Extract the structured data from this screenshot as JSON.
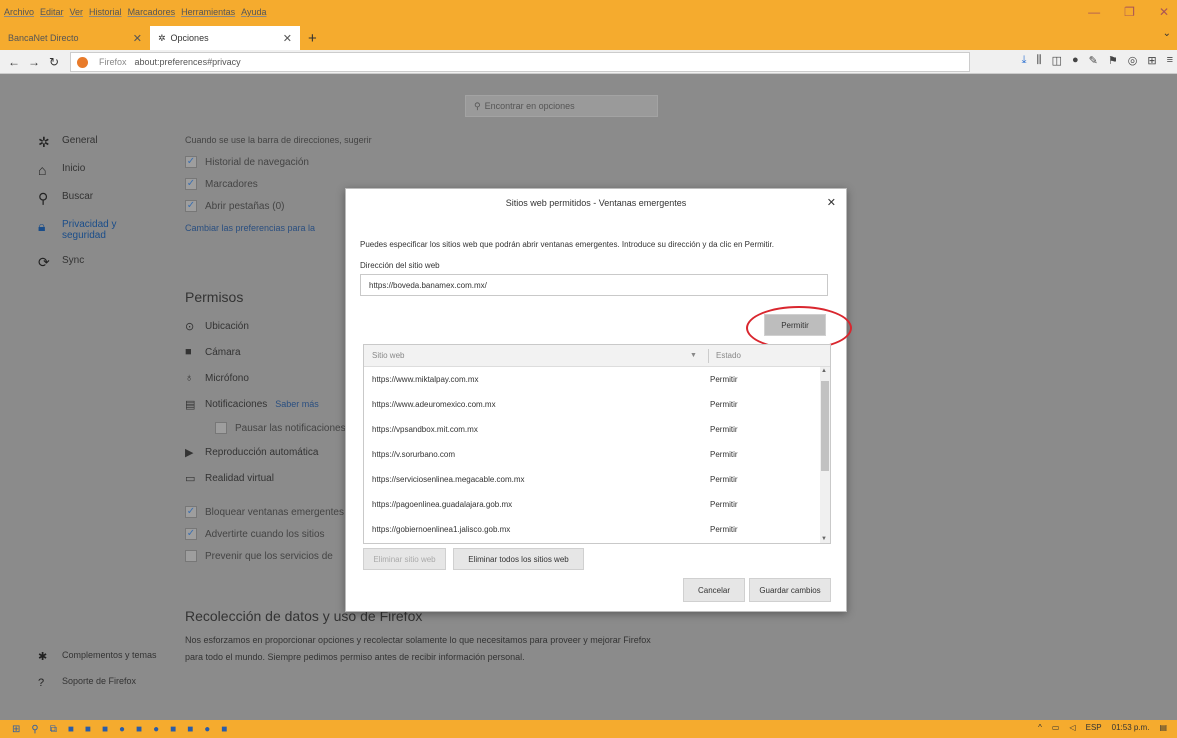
{
  "menu": [
    "Archivo",
    "Editar",
    "Ver",
    "Historial",
    "Marcadores",
    "Herramientas",
    "Ayuda"
  ],
  "tabs": [
    {
      "label": "BancaNet Directo",
      "active": false
    },
    {
      "label": "Opciones",
      "active": true
    }
  ],
  "url": {
    "brand": "Firefox",
    "address": "about:preferences#privacy"
  },
  "search": {
    "placeholder": "Encontrar en opciones"
  },
  "sidebar": {
    "items": [
      {
        "label": "General",
        "icon": "gear-icon"
      },
      {
        "label": "Inicio",
        "icon": "home-icon"
      },
      {
        "label": "Buscar",
        "icon": "search-icon"
      },
      {
        "label": "Privacidad y seguridad",
        "icon": "lock-icon",
        "selected": true
      },
      {
        "label": "Sync",
        "icon": "sync-icon"
      }
    ],
    "footer": [
      {
        "label": "Complementos y temas",
        "icon": "puzzle-icon"
      },
      {
        "label": "Soporte de Firefox",
        "icon": "help-icon"
      }
    ]
  },
  "content": {
    "address_hint": "Cuando se use la barra de direcciones, sugerir",
    "address_options": [
      "Historial de navegación",
      "Marcadores",
      "Abrir pestañas (0)"
    ],
    "change_prefs_link": "Cambiar las preferencias para la",
    "permissions_title": "Permisos",
    "permissions": [
      {
        "label": "Ubicación",
        "icon": "location-icon"
      },
      {
        "label": "Cámara",
        "icon": "camera-icon"
      },
      {
        "label": "Micrófono",
        "icon": "microphone-icon"
      },
      {
        "label": "Notificaciones",
        "icon": "notification-icon",
        "link": "Saber más"
      },
      {
        "label": "Reproducción automática",
        "icon": "autoplay-icon"
      },
      {
        "label": "Realidad virtual",
        "icon": "vr-icon"
      }
    ],
    "pause_notifications": "Pausar las notificaciones",
    "popup_options": [
      "Bloquear ventanas emergentes",
      "Advertirte cuando los sitios",
      "Prevenir que los servicios de"
    ],
    "data_title": "Recolección de datos y uso de Firefox",
    "data_desc": "Nos esforzamos en proporcionar opciones y recolectar solamente lo que necesitamos para proveer y mejorar Firefox para todo el mundo. Siempre pedimos permiso antes de recibir información personal."
  },
  "dialog": {
    "title": "Sitios web permitidos - Ventanas emergentes",
    "description": "Puedes especificar los sitios web que podrán abrir ventanas emergentes. Introduce su dirección y da clic en Permitir.",
    "address_label": "Dirección del sitio web",
    "address_value": "https://boveda.banamex.com.mx/",
    "permit_label": "Permitir",
    "col_site": "Sitio web",
    "col_status": "Estado",
    "rows": [
      {
        "site": "https://www.miktalpay.com.mx",
        "status": "Permitir"
      },
      {
        "site": "https://www.adeuromexico.com.mx",
        "status": "Permitir"
      },
      {
        "site": "https://vpsandbox.mit.com.mx",
        "status": "Permitir"
      },
      {
        "site": "https://v.sorurbano.com",
        "status": "Permitir"
      },
      {
        "site": "https://serviciosenlinea.megacable.com.mx",
        "status": "Permitir"
      },
      {
        "site": "https://pagoenlinea.guadalajara.gob.mx",
        "status": "Permitir"
      },
      {
        "site": "https://gobiernoenlinea1.jalisco.gob.mx",
        "status": "Permitir"
      }
    ],
    "remove_site": "Eliminar sitio web",
    "remove_all": "Eliminar todos los sitios web",
    "cancel": "Cancelar",
    "save": "Guardar cambios"
  },
  "taskbar": {
    "lang": "ESP",
    "time": "01:53 p.m."
  }
}
